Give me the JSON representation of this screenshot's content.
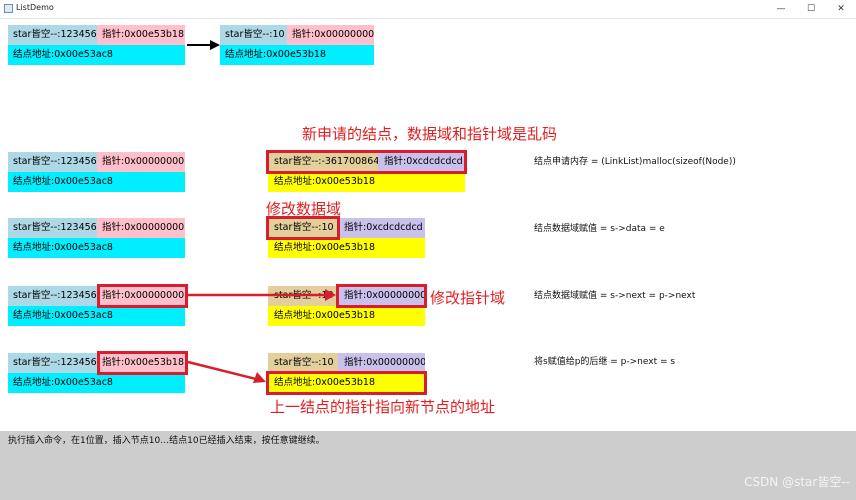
{
  "window": {
    "title": "ListDemo",
    "minimize_glyph": "—",
    "maximize_glyph": "☐",
    "close_glyph": "✕"
  },
  "nodes": {
    "r1_left": {
      "data": "star皆空--:123456",
      "ptr": "指针:0x00e53b18",
      "addr": "结点地址:0x00e53ac8"
    },
    "r1_right": {
      "data": "star皆空--:10",
      "ptr": "指针:0x00000000",
      "addr": "结点地址:0x00e53b18"
    },
    "r2_left": {
      "data": "star皆空--:123456",
      "ptr": "指针:0x00000000",
      "addr": "结点地址:0x00e53ac8"
    },
    "r2_new": {
      "data": "star皆空--:-361700864",
      "ptr": "指针:0xcdcdcdcd",
      "addr": "结点地址:0x00e53b18"
    },
    "r3_left": {
      "data": "star皆空--:123456",
      "ptr": "指针:0x00000000",
      "addr": "结点地址:0x00e53ac8"
    },
    "r3_new": {
      "data": "star皆空--:10",
      "ptr": "指针:0xcdcdcdcd",
      "addr": "结点地址:0x00e53b18"
    },
    "r4_left": {
      "data": "star皆空--:123456",
      "ptr": "指针:0x00000000",
      "addr": "结点地址:0x00e53ac8"
    },
    "r4_new": {
      "data": "star皆空--:10",
      "ptr": "指针:0x00000000",
      "addr": "结点地址:0x00e53b18"
    },
    "r5_left": {
      "data": "star皆空--:123456",
      "ptr": "指针:0x00e53b18",
      "addr": "结点地址:0x00e53ac8"
    },
    "r5_new": {
      "data": "star皆空--:10",
      "ptr": "指针:0x00000000",
      "addr": "结点地址:0x00e53b18"
    }
  },
  "annotations": {
    "new_node": "新申请的结点，数据域和指针域是乱码",
    "modify_data": "修改数据域",
    "modify_ptr": "修改指针域",
    "prev_points": "上一结点的指针指向新节点的地址"
  },
  "notes": {
    "malloc": "结点申请内存 = (LinkList)malloc(sizeof(Node))",
    "data": "结点数据域赋值 = s->data = e",
    "next": "结点数据域赋值 = s->next = p->next",
    "link": "将s赋值给p的后继 = p->next = s"
  },
  "status": {
    "text": "执行插入命令，在1位置，插入节点10…结点10已经插入结束，按任意键继续。",
    "watermark": "CSDN @star皆空--"
  },
  "colors": {
    "data_cell": "#add8e6",
    "ptr_cell": "#ffc0cb",
    "addr_cell": "#00eeff",
    "new_data_cell": "#e3cf9c",
    "new_ptr_cell": "#c9c0ec",
    "new_addr_cell": "#ffff00",
    "annotation_red": "#e02020"
  }
}
